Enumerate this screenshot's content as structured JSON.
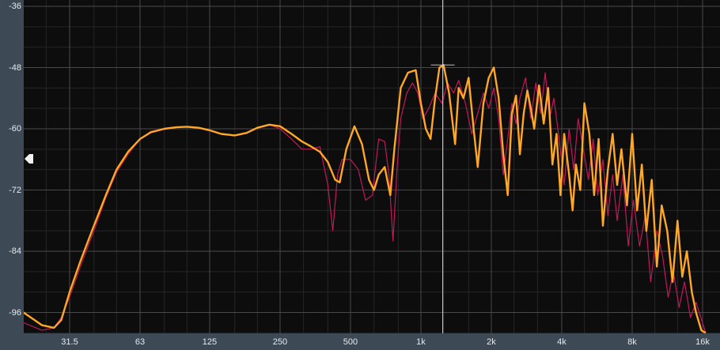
{
  "chart_data": {
    "type": "line",
    "x_scale": "log",
    "x_range_hz": [
      20,
      16500
    ],
    "y_range_db": [
      -100,
      -36
    ],
    "y_ticks": [
      "-36",
      "-48",
      "-60",
      "-72",
      "-84",
      "-96"
    ],
    "x_ticks": [
      "31.5",
      "63",
      "125",
      "250",
      "500",
      "1k",
      "2k",
      "4k",
      "8k",
      "16k"
    ],
    "grid": true,
    "cursor_hz": 1240,
    "peak_marker": {
      "hz": 1240,
      "db": -47.5
    },
    "colors": {
      "background": "#0d0d0d",
      "panel": "#3d4a56",
      "grid_major": "#4a4a4a",
      "grid_minor": "#262626",
      "series_1": "#ffa726",
      "series_2": "#c2185b",
      "cursor": "#d8d8d8"
    },
    "series": [
      {
        "style": "thick",
        "points": [
          [
            20,
            -96
          ],
          [
            24,
            -98.5
          ],
          [
            27,
            -99
          ],
          [
            29,
            -97.5
          ],
          [
            31.5,
            -92
          ],
          [
            35,
            -86
          ],
          [
            40,
            -79
          ],
          [
            45,
            -73
          ],
          [
            50,
            -68
          ],
          [
            56,
            -64.5
          ],
          [
            63,
            -62
          ],
          [
            70,
            -60.7
          ],
          [
            80,
            -60
          ],
          [
            90,
            -59.7
          ],
          [
            100,
            -59.6
          ],
          [
            112,
            -59.8
          ],
          [
            125,
            -60.3
          ],
          [
            140,
            -61
          ],
          [
            160,
            -61.3
          ],
          [
            180,
            -60.8
          ],
          [
            200,
            -59.8
          ],
          [
            225,
            -59.2
          ],
          [
            250,
            -59.5
          ],
          [
            280,
            -61
          ],
          [
            310,
            -62.5
          ],
          [
            340,
            -63.5
          ],
          [
            370,
            -64.5
          ],
          [
            400,
            -66.5
          ],
          [
            430,
            -70
          ],
          [
            450,
            -70.5
          ],
          [
            480,
            -64
          ],
          [
            520,
            -59.5
          ],
          [
            560,
            -63
          ],
          [
            600,
            -70
          ],
          [
            630,
            -72
          ],
          [
            660,
            -69
          ],
          [
            700,
            -67.5
          ],
          [
            740,
            -73
          ],
          [
            770,
            -64
          ],
          [
            820,
            -52
          ],
          [
            880,
            -49
          ],
          [
            950,
            -48.5
          ],
          [
            1000,
            -55
          ],
          [
            1050,
            -60
          ],
          [
            1100,
            -62
          ],
          [
            1150,
            -54
          ],
          [
            1200,
            -48
          ],
          [
            1250,
            -47.5
          ],
          [
            1320,
            -53
          ],
          [
            1400,
            -63
          ],
          [
            1450,
            -52
          ],
          [
            1520,
            -54
          ],
          [
            1600,
            -50
          ],
          [
            1680,
            -60
          ],
          [
            1750,
            -67.5
          ],
          [
            1850,
            -55
          ],
          [
            1950,
            -50
          ],
          [
            2050,
            -48
          ],
          [
            2150,
            -54
          ],
          [
            2250,
            -65
          ],
          [
            2350,
            -73
          ],
          [
            2450,
            -57
          ],
          [
            2550,
            -53.5
          ],
          [
            2650,
            -65
          ],
          [
            2750,
            -57
          ],
          [
            2850,
            -52.5
          ],
          [
            2950,
            -56
          ],
          [
            3050,
            -60
          ],
          [
            3200,
            -51.5
          ],
          [
            3350,
            -59
          ],
          [
            3500,
            -52
          ],
          [
            3650,
            -67
          ],
          [
            3800,
            -61
          ],
          [
            3950,
            -73
          ],
          [
            4100,
            -61
          ],
          [
            4300,
            -69
          ],
          [
            4450,
            -76
          ],
          [
            4600,
            -67
          ],
          [
            4800,
            -72
          ],
          [
            5000,
            -55
          ],
          [
            5250,
            -61
          ],
          [
            5500,
            -73
          ],
          [
            5750,
            -62
          ],
          [
            6000,
            -79
          ],
          [
            6300,
            -68
          ],
          [
            6600,
            -61
          ],
          [
            6900,
            -71
          ],
          [
            7200,
            -64
          ],
          [
            7600,
            -75
          ],
          [
            8000,
            -61
          ],
          [
            8400,
            -76
          ],
          [
            8800,
            -67
          ],
          [
            9200,
            -80
          ],
          [
            9700,
            -70
          ],
          [
            10200,
            -87
          ],
          [
            10700,
            -75
          ],
          [
            11300,
            -80
          ],
          [
            11900,
            -90
          ],
          [
            12500,
            -78
          ],
          [
            13100,
            -89
          ],
          [
            13700,
            -84
          ],
          [
            14400,
            -92
          ],
          [
            15000,
            -96
          ],
          [
            15800,
            -99.5
          ],
          [
            16500,
            -100
          ]
        ]
      },
      {
        "style": "thin",
        "points": [
          [
            20,
            -98
          ],
          [
            24,
            -99.5
          ],
          [
            27,
            -99
          ],
          [
            29,
            -97
          ],
          [
            31.5,
            -93
          ],
          [
            35,
            -87
          ],
          [
            40,
            -80
          ],
          [
            45,
            -73.5
          ],
          [
            50,
            -68.5
          ],
          [
            56,
            -65
          ],
          [
            63,
            -62
          ],
          [
            70,
            -60.5
          ],
          [
            80,
            -60
          ],
          [
            90,
            -59.7
          ],
          [
            100,
            -59.6
          ],
          [
            112,
            -59.8
          ],
          [
            125,
            -60.3
          ],
          [
            140,
            -61
          ],
          [
            160,
            -61.3
          ],
          [
            180,
            -60.8
          ],
          [
            200,
            -59.8
          ],
          [
            225,
            -59.2
          ],
          [
            250,
            -60
          ],
          [
            280,
            -62
          ],
          [
            310,
            -64
          ],
          [
            340,
            -64
          ],
          [
            370,
            -63.5
          ],
          [
            400,
            -71
          ],
          [
            420,
            -80
          ],
          [
            440,
            -69
          ],
          [
            460,
            -66
          ],
          [
            500,
            -66
          ],
          [
            540,
            -68
          ],
          [
            580,
            -74
          ],
          [
            620,
            -73
          ],
          [
            660,
            -62
          ],
          [
            700,
            -62.5
          ],
          [
            730,
            -69
          ],
          [
            760,
            -82
          ],
          [
            790,
            -68
          ],
          [
            820,
            -58
          ],
          [
            870,
            -53
          ],
          [
            920,
            -51
          ],
          [
            970,
            -53
          ],
          [
            1020,
            -58
          ],
          [
            1080,
            -56
          ],
          [
            1150,
            -53
          ],
          [
            1230,
            -55
          ],
          [
            1300,
            -51
          ],
          [
            1380,
            -53
          ],
          [
            1450,
            -50.5
          ],
          [
            1550,
            -55
          ],
          [
            1650,
            -61
          ],
          [
            1750,
            -57
          ],
          [
            1850,
            -53
          ],
          [
            1950,
            -56
          ],
          [
            2050,
            -52
          ],
          [
            2150,
            -58
          ],
          [
            2250,
            -69
          ],
          [
            2350,
            -62
          ],
          [
            2450,
            -55
          ],
          [
            2550,
            -59
          ],
          [
            2650,
            -54
          ],
          [
            2800,
            -50
          ],
          [
            2950,
            -58
          ],
          [
            3100,
            -51
          ],
          [
            3250,
            -57
          ],
          [
            3400,
            -49
          ],
          [
            3550,
            -58
          ],
          [
            3700,
            -54
          ],
          [
            3900,
            -62
          ],
          [
            4100,
            -71
          ],
          [
            4300,
            -60
          ],
          [
            4500,
            -68
          ],
          [
            4700,
            -58
          ],
          [
            4950,
            -64
          ],
          [
            5200,
            -70
          ],
          [
            5450,
            -62
          ],
          [
            5700,
            -73
          ],
          [
            6000,
            -66
          ],
          [
            6300,
            -77
          ],
          [
            6600,
            -69
          ],
          [
            6900,
            -78
          ],
          [
            7300,
            -69
          ],
          [
            7700,
            -83
          ],
          [
            8100,
            -74
          ],
          [
            8600,
            -83
          ],
          [
            9100,
            -77
          ],
          [
            9600,
            -90
          ],
          [
            10200,
            -80
          ],
          [
            10800,
            -85
          ],
          [
            11400,
            -93
          ],
          [
            12000,
            -88
          ],
          [
            12700,
            -95
          ],
          [
            13400,
            -90
          ],
          [
            14200,
            -97
          ],
          [
            15000,
            -94
          ],
          [
            16500,
            -100
          ]
        ]
      }
    ]
  },
  "controls": {
    "level_handle_icon": "triangle-left-icon"
  }
}
